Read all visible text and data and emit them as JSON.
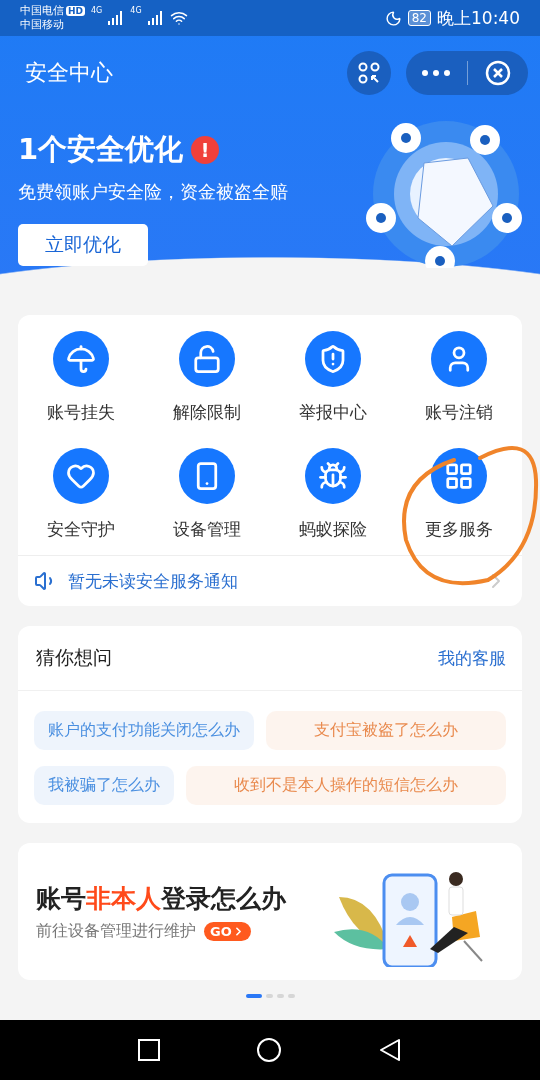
{
  "status_bar": {
    "carrier_1": "中国电信",
    "hd_badge": "HD",
    "carrier_2": "中国移动",
    "network_1": "4G",
    "network_2": "4G",
    "battery": "82",
    "time": "晚上10:40"
  },
  "header": {
    "title": "安全中心"
  },
  "hero": {
    "headline": "1个安全优化",
    "alert_mark": "!",
    "subtitle": "免费领账户安全险，资金被盗全赔",
    "button": "立即优化"
  },
  "services": [
    {
      "label": "账号挂失"
    },
    {
      "label": "解除限制"
    },
    {
      "label": "举报中心"
    },
    {
      "label": "账号注销"
    },
    {
      "label": "安全守护"
    },
    {
      "label": "设备管理"
    },
    {
      "label": "蚂蚁探险"
    },
    {
      "label": "更多服务"
    }
  ],
  "notice": {
    "text": "暂无未读安全服务通知"
  },
  "faq": {
    "title": "猜你想问",
    "link": "我的客服",
    "questions": [
      {
        "text": "账户的支付功能关闭怎么办",
        "color": "#4a8fe0"
      },
      {
        "text": "支付宝被盗了怎么办",
        "color": "#e98a4e"
      },
      {
        "text": "我被骗了怎么办",
        "color": "#4a8fe0"
      },
      {
        "text": "收到不是本人操作的短信怎么办",
        "color": "#e98a4e"
      }
    ]
  },
  "banner": {
    "title_before": "账号",
    "title_highlight": "非本人",
    "title_after": "登录怎么办",
    "subtitle": "前往设备管理进行维护",
    "go": "GO"
  },
  "pager": [
    {
      "selected": true
    },
    {
      "selected": false
    },
    {
      "selected": false
    },
    {
      "selected": false
    }
  ]
}
